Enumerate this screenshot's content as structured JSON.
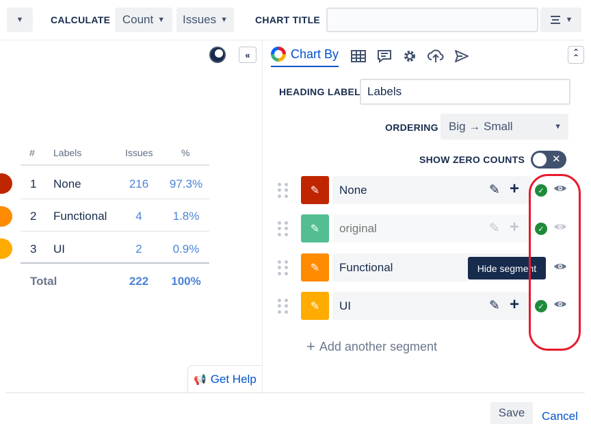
{
  "toolbar": {
    "calculate_label": "CALCULATE",
    "count_select": "Count",
    "issues_select": "Issues",
    "chart_title_label": "CHART TITLE",
    "chart_title_value": ""
  },
  "table": {
    "headers": [
      "#",
      "Labels",
      "Issues",
      "%"
    ],
    "rows": [
      {
        "num": "1",
        "label": "None",
        "issues": "216",
        "pct": "97.3%",
        "color": "#bf2600"
      },
      {
        "num": "2",
        "label": "Functional",
        "issues": "4",
        "pct": "1.8%",
        "color": "#ff8b00"
      },
      {
        "num": "3",
        "label": "UI",
        "issues": "2",
        "pct": "0.9%",
        "color": "#ffab00"
      }
    ],
    "total": {
      "label": "Total",
      "issues": "222",
      "pct": "100%"
    }
  },
  "panel": {
    "active_tab": "Chart By",
    "heading_label_caption": "HEADING LABEL",
    "heading_label_value": "Labels",
    "ordering_caption": "ORDERING",
    "ordering_value": "Big → Small",
    "show_zero_caption": "SHOW ZERO COUNTS",
    "show_zero_enabled": false,
    "segments": [
      {
        "name": "None",
        "placeholder": "",
        "color": "#bf2600",
        "dimmed": false
      },
      {
        "name": "",
        "placeholder": "original",
        "color": "#36b37e",
        "dimmed": true
      },
      {
        "name": "Functional",
        "placeholder": "",
        "color": "#ff8b00",
        "dimmed": false
      },
      {
        "name": "UI",
        "placeholder": "",
        "color": "#ffab00",
        "dimmed": false
      }
    ],
    "add_segment_label": "Add another segment",
    "tooltip": "Hide segment"
  },
  "help": {
    "label": "Get Help"
  },
  "footer": {
    "save_label": "Save",
    "cancel_label": "Cancel"
  },
  "colors": {
    "accent": "#0052cc",
    "link": "#4a83d8",
    "check": "#1f8a3b",
    "highlight": "#e8192c"
  }
}
